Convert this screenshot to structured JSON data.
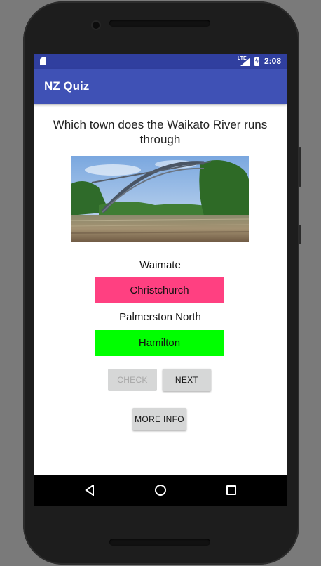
{
  "status_bar": {
    "network": "LTE",
    "time": "2:08"
  },
  "app_bar": {
    "title": "NZ Quiz"
  },
  "question": {
    "text": "Which town does the Waikato River runs through"
  },
  "answers": [
    {
      "label": "Waimate",
      "style": "text"
    },
    {
      "label": "Christchurch",
      "style": "button",
      "color": "#ff4081"
    },
    {
      "label": "Palmerston North",
      "style": "text"
    },
    {
      "label": "Hamilton",
      "style": "button",
      "color": "#00ff00"
    }
  ],
  "buttons": {
    "check": "CHECK",
    "next": "NEXT",
    "more_info": "MORE INFO"
  },
  "colors": {
    "primary": "#3f51b5",
    "primary_dark": "#303f9f",
    "wrong": "#ff4081",
    "correct": "#00ff00"
  },
  "icons": [
    "sd-card-icon",
    "lte-signal-icon",
    "battery-charging-icon",
    "nav-back-icon",
    "nav-home-icon",
    "nav-recents-icon"
  ]
}
